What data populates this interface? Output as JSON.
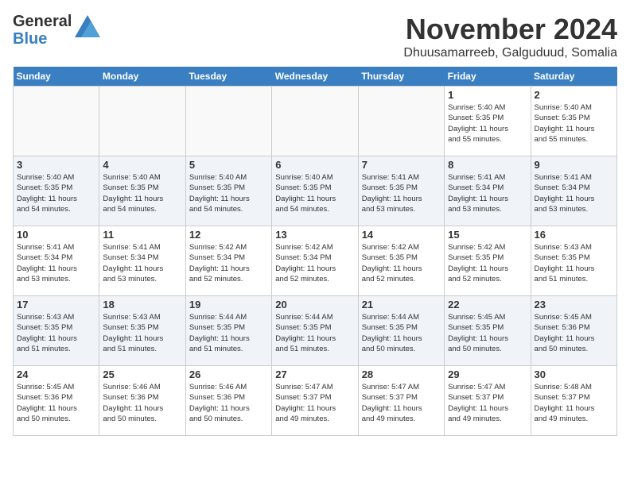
{
  "header": {
    "logo_line1": "General",
    "logo_line2": "Blue",
    "month_title": "November 2024",
    "location": "Dhuusamarreeb, Galguduud, Somalia"
  },
  "weekdays": [
    "Sunday",
    "Monday",
    "Tuesday",
    "Wednesday",
    "Thursday",
    "Friday",
    "Saturday"
  ],
  "weeks": [
    [
      {
        "day": "",
        "info": ""
      },
      {
        "day": "",
        "info": ""
      },
      {
        "day": "",
        "info": ""
      },
      {
        "day": "",
        "info": ""
      },
      {
        "day": "",
        "info": ""
      },
      {
        "day": "1",
        "info": "Sunrise: 5:40 AM\nSunset: 5:35 PM\nDaylight: 11 hours\nand 55 minutes."
      },
      {
        "day": "2",
        "info": "Sunrise: 5:40 AM\nSunset: 5:35 PM\nDaylight: 11 hours\nand 55 minutes."
      }
    ],
    [
      {
        "day": "3",
        "info": "Sunrise: 5:40 AM\nSunset: 5:35 PM\nDaylight: 11 hours\nand 54 minutes."
      },
      {
        "day": "4",
        "info": "Sunrise: 5:40 AM\nSunset: 5:35 PM\nDaylight: 11 hours\nand 54 minutes."
      },
      {
        "day": "5",
        "info": "Sunrise: 5:40 AM\nSunset: 5:35 PM\nDaylight: 11 hours\nand 54 minutes."
      },
      {
        "day": "6",
        "info": "Sunrise: 5:40 AM\nSunset: 5:35 PM\nDaylight: 11 hours\nand 54 minutes."
      },
      {
        "day": "7",
        "info": "Sunrise: 5:41 AM\nSunset: 5:35 PM\nDaylight: 11 hours\nand 53 minutes."
      },
      {
        "day": "8",
        "info": "Sunrise: 5:41 AM\nSunset: 5:34 PM\nDaylight: 11 hours\nand 53 minutes."
      },
      {
        "day": "9",
        "info": "Sunrise: 5:41 AM\nSunset: 5:34 PM\nDaylight: 11 hours\nand 53 minutes."
      }
    ],
    [
      {
        "day": "10",
        "info": "Sunrise: 5:41 AM\nSunset: 5:34 PM\nDaylight: 11 hours\nand 53 minutes."
      },
      {
        "day": "11",
        "info": "Sunrise: 5:41 AM\nSunset: 5:34 PM\nDaylight: 11 hours\nand 53 minutes."
      },
      {
        "day": "12",
        "info": "Sunrise: 5:42 AM\nSunset: 5:34 PM\nDaylight: 11 hours\nand 52 minutes."
      },
      {
        "day": "13",
        "info": "Sunrise: 5:42 AM\nSunset: 5:34 PM\nDaylight: 11 hours\nand 52 minutes."
      },
      {
        "day": "14",
        "info": "Sunrise: 5:42 AM\nSunset: 5:35 PM\nDaylight: 11 hours\nand 52 minutes."
      },
      {
        "day": "15",
        "info": "Sunrise: 5:42 AM\nSunset: 5:35 PM\nDaylight: 11 hours\nand 52 minutes."
      },
      {
        "day": "16",
        "info": "Sunrise: 5:43 AM\nSunset: 5:35 PM\nDaylight: 11 hours\nand 51 minutes."
      }
    ],
    [
      {
        "day": "17",
        "info": "Sunrise: 5:43 AM\nSunset: 5:35 PM\nDaylight: 11 hours\nand 51 minutes."
      },
      {
        "day": "18",
        "info": "Sunrise: 5:43 AM\nSunset: 5:35 PM\nDaylight: 11 hours\nand 51 minutes."
      },
      {
        "day": "19",
        "info": "Sunrise: 5:44 AM\nSunset: 5:35 PM\nDaylight: 11 hours\nand 51 minutes."
      },
      {
        "day": "20",
        "info": "Sunrise: 5:44 AM\nSunset: 5:35 PM\nDaylight: 11 hours\nand 51 minutes."
      },
      {
        "day": "21",
        "info": "Sunrise: 5:44 AM\nSunset: 5:35 PM\nDaylight: 11 hours\nand 50 minutes."
      },
      {
        "day": "22",
        "info": "Sunrise: 5:45 AM\nSunset: 5:35 PM\nDaylight: 11 hours\nand 50 minutes."
      },
      {
        "day": "23",
        "info": "Sunrise: 5:45 AM\nSunset: 5:36 PM\nDaylight: 11 hours\nand 50 minutes."
      }
    ],
    [
      {
        "day": "24",
        "info": "Sunrise: 5:45 AM\nSunset: 5:36 PM\nDaylight: 11 hours\nand 50 minutes."
      },
      {
        "day": "25",
        "info": "Sunrise: 5:46 AM\nSunset: 5:36 PM\nDaylight: 11 hours\nand 50 minutes."
      },
      {
        "day": "26",
        "info": "Sunrise: 5:46 AM\nSunset: 5:36 PM\nDaylight: 11 hours\nand 50 minutes."
      },
      {
        "day": "27",
        "info": "Sunrise: 5:47 AM\nSunset: 5:37 PM\nDaylight: 11 hours\nand 49 minutes."
      },
      {
        "day": "28",
        "info": "Sunrise: 5:47 AM\nSunset: 5:37 PM\nDaylight: 11 hours\nand 49 minutes."
      },
      {
        "day": "29",
        "info": "Sunrise: 5:47 AM\nSunset: 5:37 PM\nDaylight: 11 hours\nand 49 minutes."
      },
      {
        "day": "30",
        "info": "Sunrise: 5:48 AM\nSunset: 5:37 PM\nDaylight: 11 hours\nand 49 minutes."
      }
    ]
  ]
}
